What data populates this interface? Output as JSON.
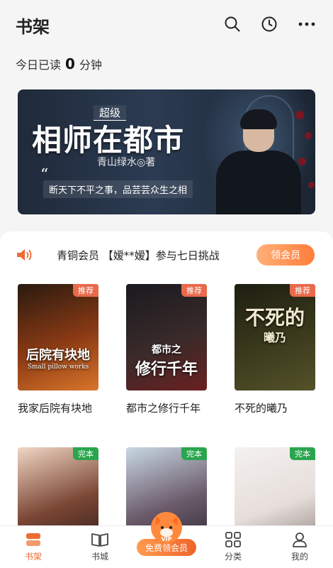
{
  "header": {
    "title": "书架"
  },
  "reading": {
    "prefix": "今日已读",
    "minutes": "0",
    "suffix": "分钟"
  },
  "banner": {
    "title_small": "超级",
    "title": "相师在都市",
    "author": "青山绿水◎著",
    "slogan": "断天下不平之事，品芸芸众生之相"
  },
  "notice": {
    "text": "青铜会员 【嫒**嫒】参与七日挑战",
    "button": "领会员"
  },
  "books": [
    {
      "name": "我家后院有块地",
      "badge": "推荐",
      "cover_text": "后院有块地",
      "cover_sub": "Small pillow works",
      "colors": [
        "#2a1a10",
        "#8a3a14",
        "#d9752a"
      ]
    },
    {
      "name": "都市之修行千年",
      "badge": "推荐",
      "cover_text": "修行千年",
      "cover_sub": "都市之",
      "colors": [
        "#1a1a1f",
        "#3a2a2a",
        "#6b2020"
      ]
    },
    {
      "name": "不死的曦乃",
      "badge": "推荐",
      "cover_text": "不死的",
      "cover_sub": "曦乃",
      "colors": [
        "#1e1e12",
        "#3b3a1c",
        "#54522a"
      ]
    },
    {
      "name": "",
      "badge": "完本",
      "cover_text": "",
      "cover_sub": "",
      "colors": [
        "#f1d6c4",
        "#7a4634",
        "#2b1a1a"
      ]
    },
    {
      "name": "",
      "badge": "完本",
      "cover_text": "",
      "cover_sub": "",
      "colors": [
        "#c9d8e4",
        "#6b5a6a",
        "#2a2530"
      ]
    },
    {
      "name": "",
      "badge": "完本",
      "cover_text": "",
      "cover_sub": "",
      "colors": [
        "#f4f1ef",
        "#e6dedb",
        "#8a7c78"
      ]
    }
  ],
  "tabs": {
    "shelf": "书架",
    "store": "书城",
    "vip": "免费领会员",
    "vip_mark": "VIP",
    "category": "分类",
    "mine": "我的"
  },
  "colors": {
    "accent": "#f06a33",
    "badge_recommend": "#e86a4a",
    "badge_finished": "#2aa54e"
  }
}
